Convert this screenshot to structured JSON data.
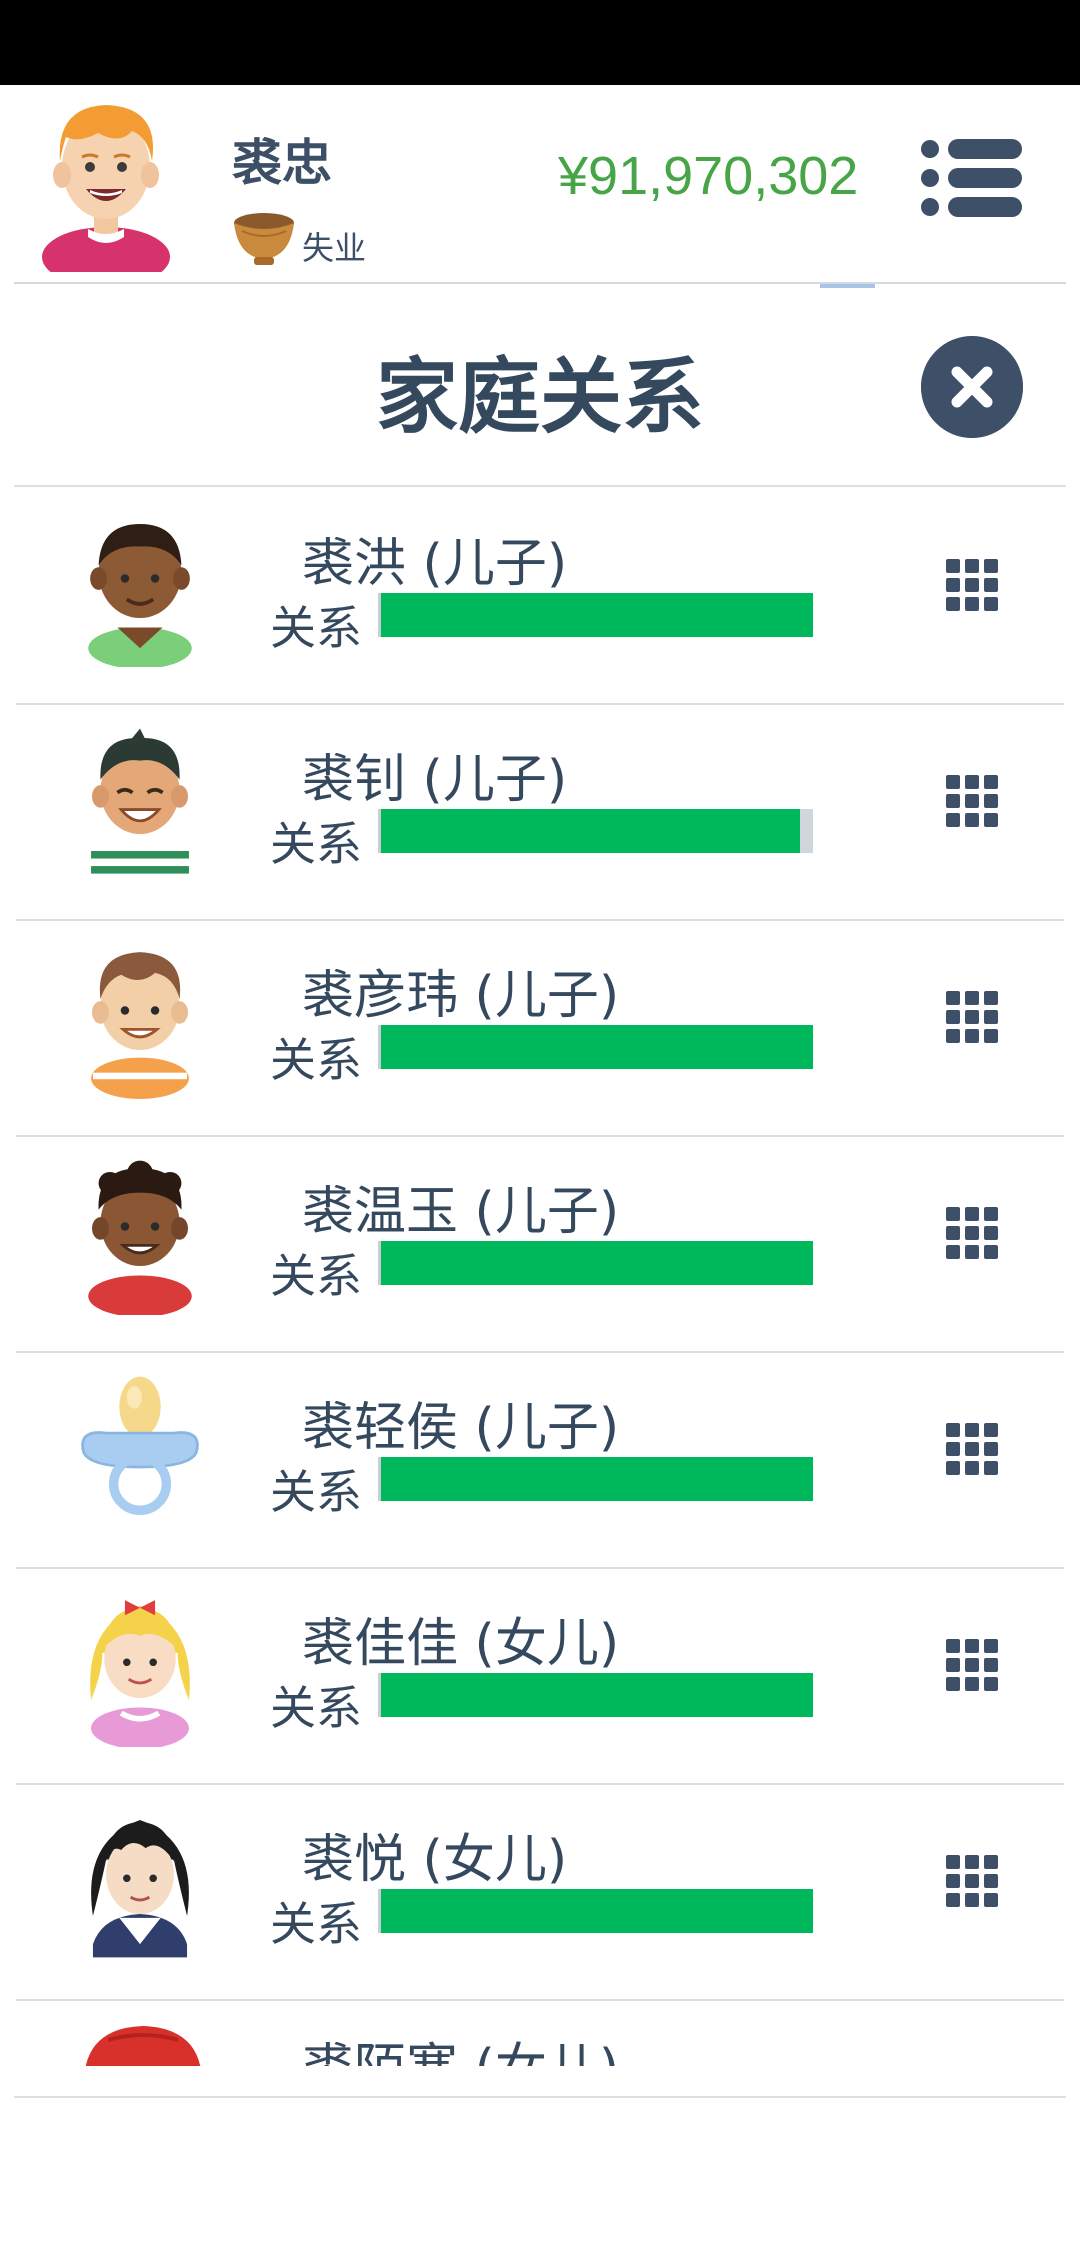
{
  "header": {
    "player_name": "裘忠",
    "job": "失业",
    "money": "¥91,970,302"
  },
  "modal": {
    "title": "家庭关系"
  },
  "relation_label": "关系",
  "family": [
    {
      "name": "裘洪 (儿子)",
      "relationship": 1.0,
      "avatar": "boy-dark-green-shirt"
    },
    {
      "name": "裘钊 (儿子)",
      "relationship": 0.97,
      "avatar": "boy-striped-shirt"
    },
    {
      "name": "裘彦玮 (儿子)",
      "relationship": 1.0,
      "avatar": "boy-orange-striped-shirt"
    },
    {
      "name": "裘温玉 (儿子)",
      "relationship": 1.0,
      "avatar": "boy-curly-red-shirt"
    },
    {
      "name": "裘轻侯 (儿子)",
      "relationship": 1.0,
      "avatar": "pacifier-icon"
    },
    {
      "name": "裘佳佳 (女儿)",
      "relationship": 1.0,
      "avatar": "girl-blonde-pink"
    },
    {
      "name": "裘悦 (女儿)",
      "relationship": 1.0,
      "avatar": "girl-black-hair-sailor"
    }
  ],
  "partial_row": {
    "name": "裘陌寒 (女儿)",
    "avatar": "red-hat"
  },
  "colors": {
    "money": "#47a447",
    "bar_fill": "#00b85c",
    "text": "#34495e",
    "close_bg": "#3e5068"
  }
}
